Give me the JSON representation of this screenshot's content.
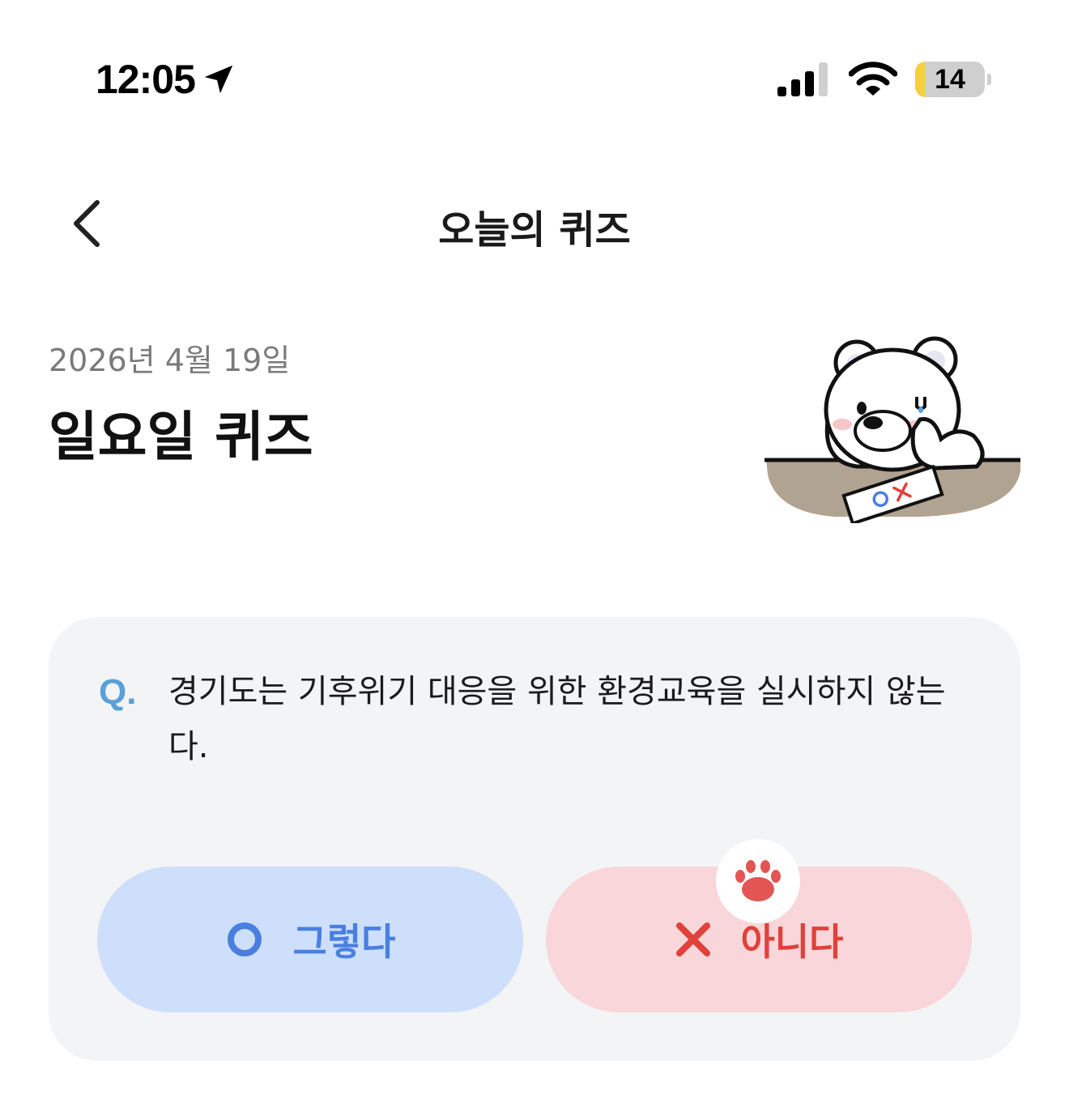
{
  "status_bar": {
    "time": "12:05",
    "battery_level": "14",
    "battery_fraction": 0.14,
    "icons": [
      "location-arrow-icon",
      "cellular-signal-icon",
      "wifi-icon",
      "battery-icon"
    ]
  },
  "nav": {
    "title": "오늘의 퀴즈",
    "back_icon": "chevron-left-icon"
  },
  "header": {
    "date": "2026년 4월 19일",
    "heading": "일요일 퀴즈"
  },
  "quiz": {
    "q_marker": "Q.",
    "question": "경기도는 기후위기 대응을 위한 환경교육을 실시하지 않는다.",
    "answers": [
      {
        "label": "그렇다",
        "icon": "circle-o-icon",
        "color": "#4a7fe0",
        "background": "#cddffa"
      },
      {
        "label": "아니다",
        "icon": "x-mark-icon",
        "color": "#e0413a",
        "background": "#f8d6d9"
      }
    ],
    "badge_icon": "paw-icon"
  },
  "colors": {
    "accent_blue": "#5a9fd6",
    "card_background": "#f3f4f6",
    "battery_yellow": "#f5cf3c"
  }
}
